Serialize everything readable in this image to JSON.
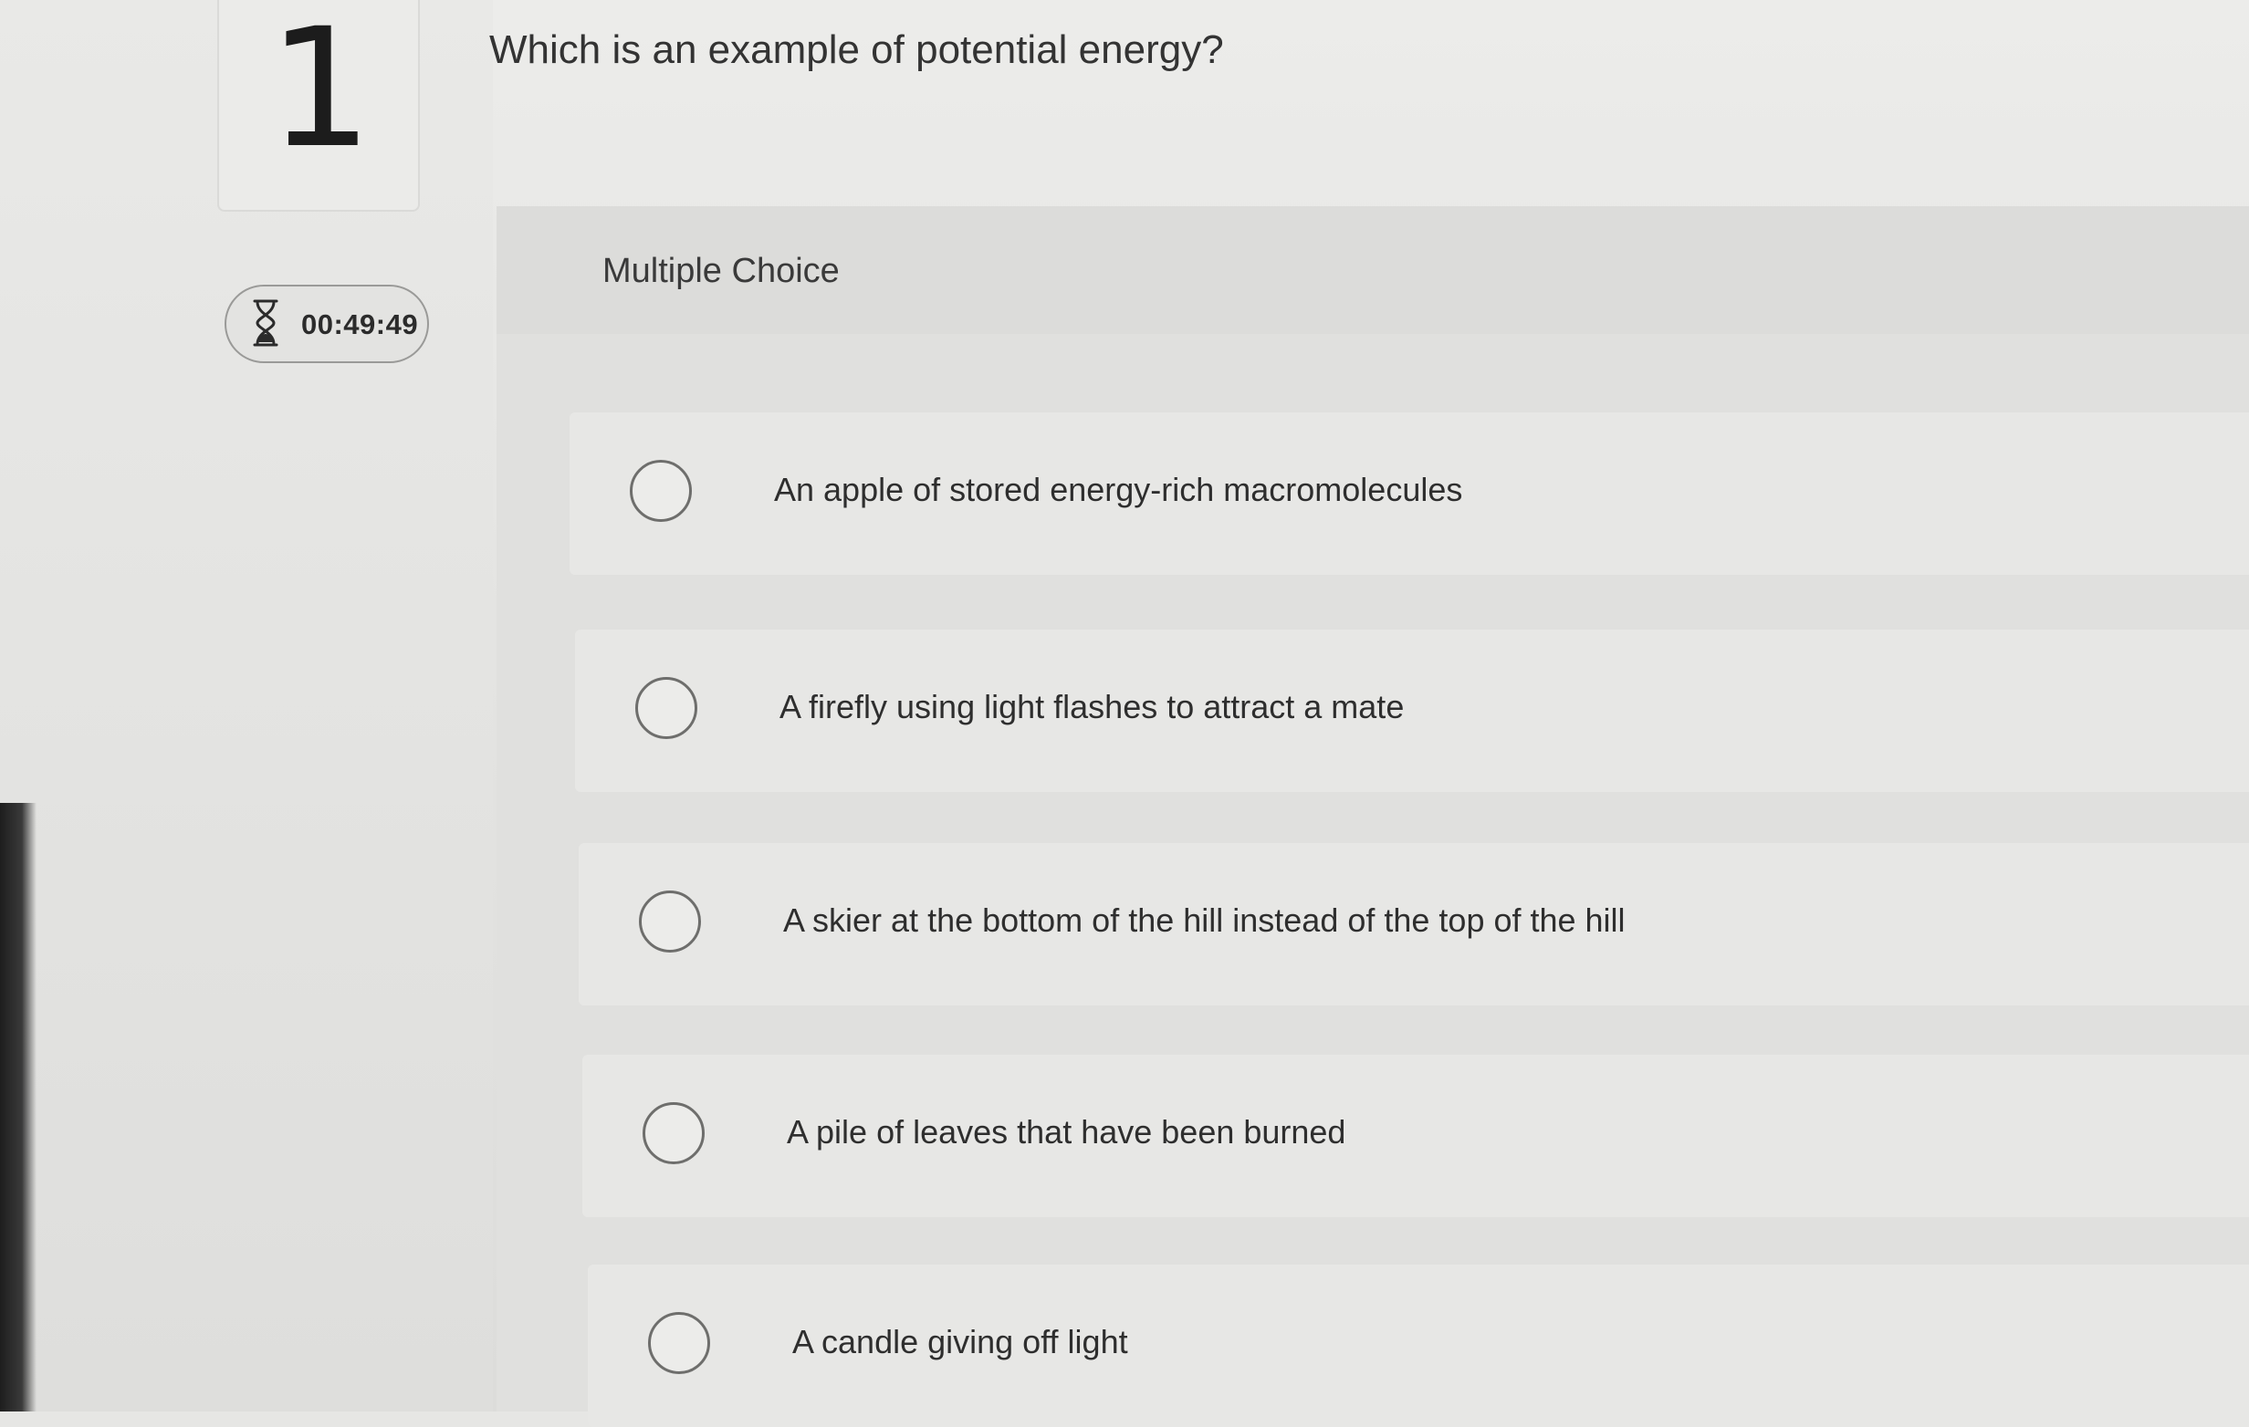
{
  "question": {
    "number": "1",
    "text": "Which is an example of potential energy?"
  },
  "timer": {
    "icon": "hourglass-icon",
    "value": "00:49:49"
  },
  "panel": {
    "title": "Multiple Choice"
  },
  "options": [
    {
      "label": "An apple of stored energy-rich macromolecules",
      "selected": false
    },
    {
      "label": "A firefly using light flashes to attract a mate",
      "selected": false
    },
    {
      "label": "A skier at the bottom of the hill instead of the top of the hill",
      "selected": false
    },
    {
      "label": "A pile of leaves that have been burned",
      "selected": false
    },
    {
      "label": "A candle giving off light",
      "selected": false
    }
  ]
}
